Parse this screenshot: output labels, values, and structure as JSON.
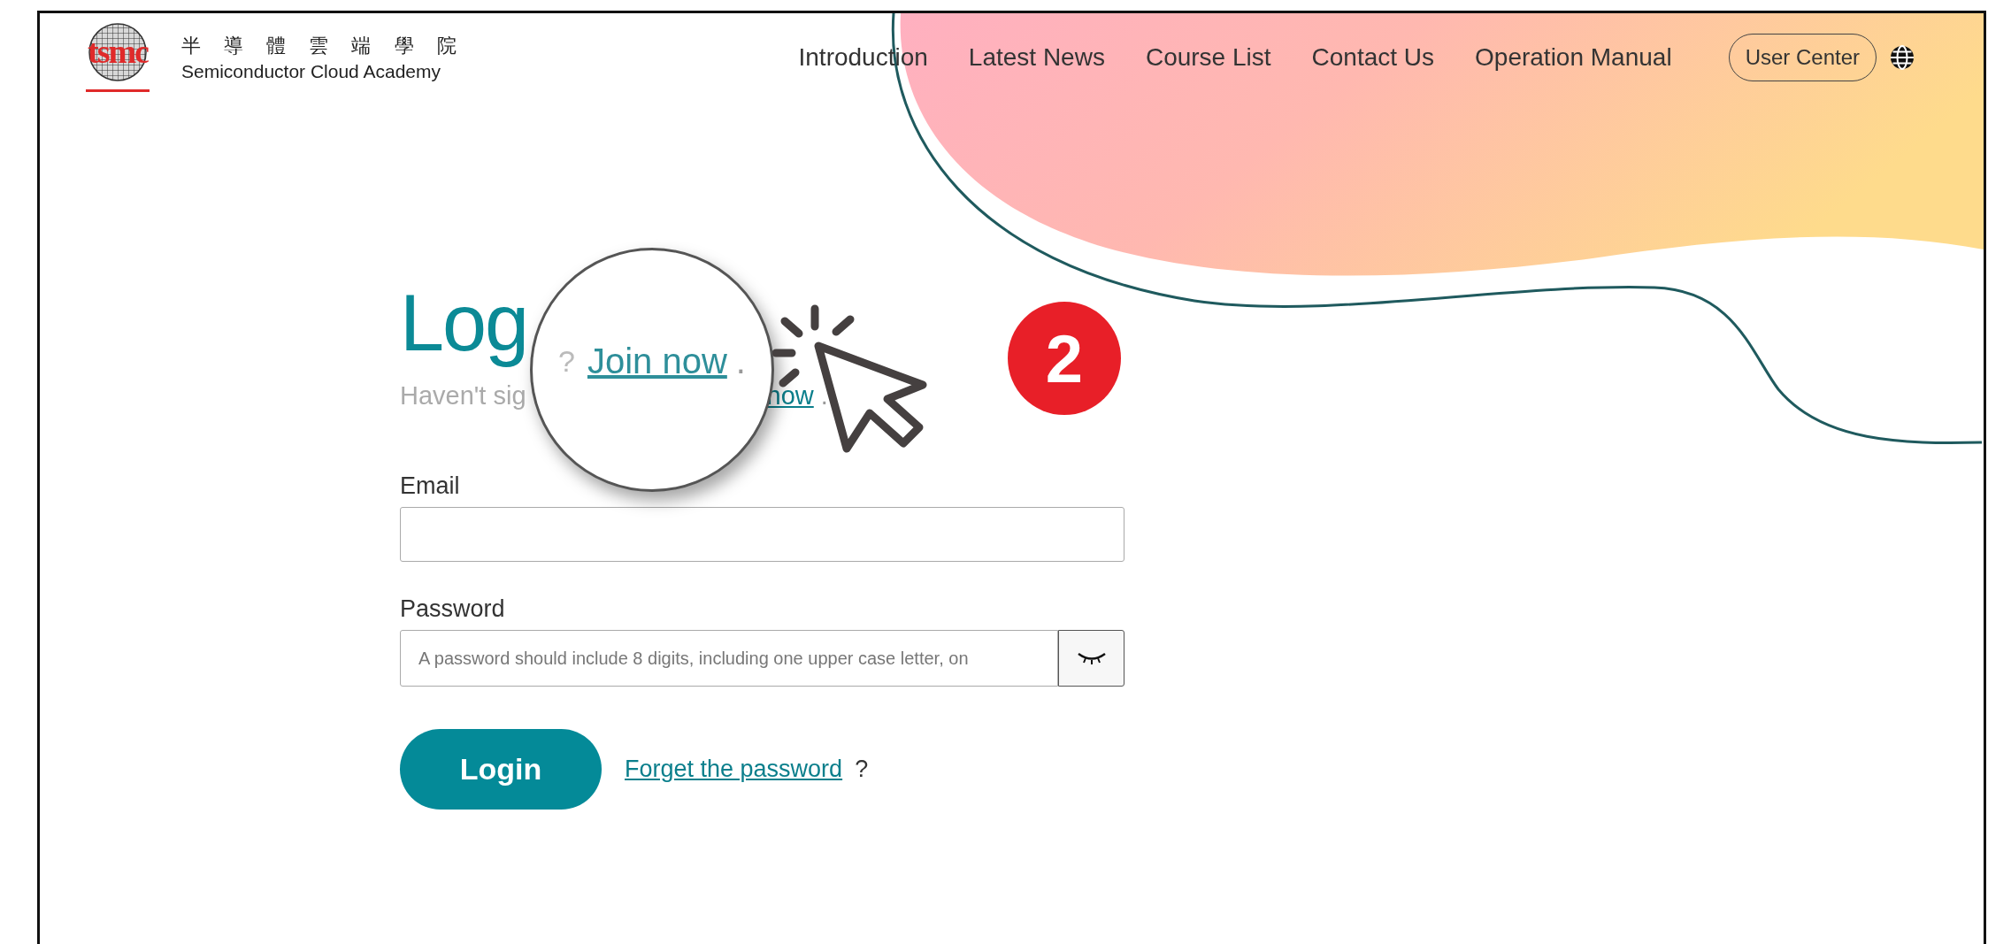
{
  "header": {
    "logo": {
      "mark": "tsmc",
      "title_zh": "半 導 體 雲 端 學 院",
      "title_en": "Semiconductor Cloud Academy"
    },
    "nav": [
      {
        "label": "Introduction"
      },
      {
        "label": "Latest News"
      },
      {
        "label": "Course List"
      },
      {
        "label": "Contact Us"
      },
      {
        "label": "Operation Manual"
      }
    ],
    "user_center": "User Center"
  },
  "login": {
    "title": "Log",
    "subtitle": "Haven't sig",
    "signup_link": "now",
    "subtitle_end": ".",
    "email_label": "Email",
    "password_label": "Password",
    "password_placeholder": "A password should include 8 digits, including one upper case letter, on",
    "password_visible": false,
    "login_button": "Login",
    "forget_link": "Forget the password",
    "forget_suffix": "?"
  },
  "annotation": {
    "magnifier": {
      "prefix": "?",
      "link": "Join now",
      "suffix": "."
    },
    "step": "2"
  }
}
